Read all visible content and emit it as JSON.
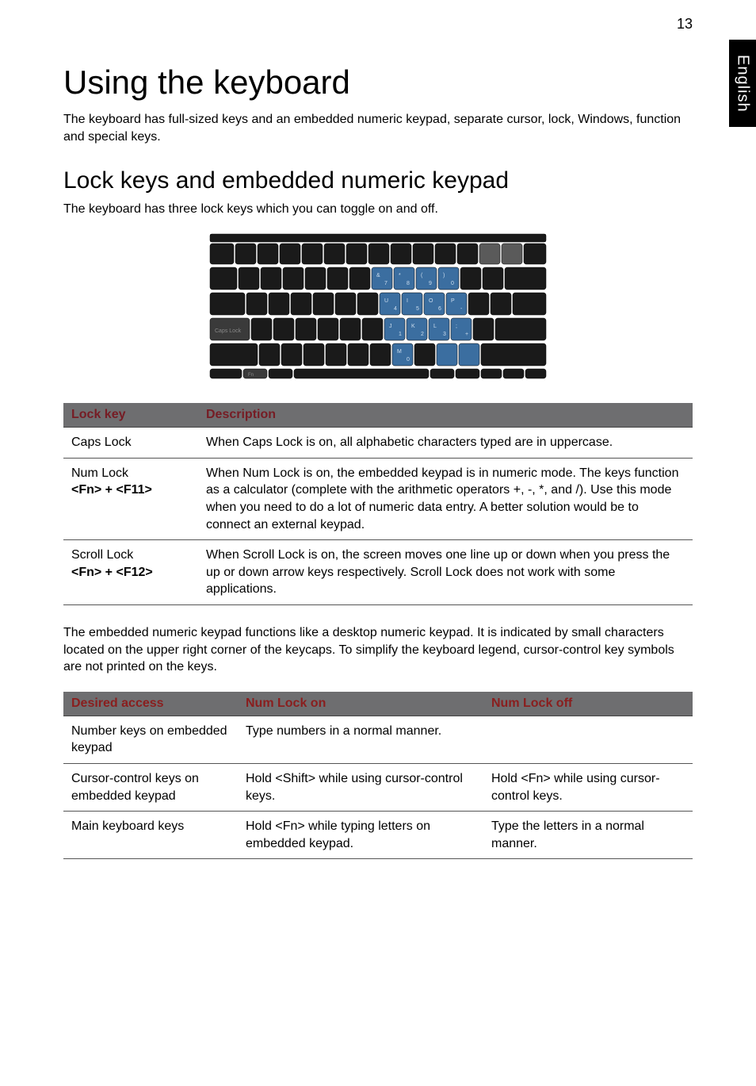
{
  "page_number": "13",
  "side_tab": "English",
  "h1": "Using the keyboard",
  "intro": "The keyboard has full-sized keys and an embedded numeric keypad, separate cursor, lock, Windows, function and special keys.",
  "h2": "Lock keys and embedded numeric keypad",
  "sub": "The keyboard has three lock keys which you can toggle on and off.",
  "table1": {
    "headers": [
      "Lock key",
      "Description"
    ],
    "rows": [
      {
        "key": "Caps Lock",
        "combo": "",
        "desc": "When Caps Lock is on, all alphabetic characters typed are in uppercase."
      },
      {
        "key": "Num Lock",
        "combo": "<Fn> + <F11>",
        "desc": "When Num Lock is on, the embedded keypad is in numeric mode. The keys function as a calculator (complete with the arithmetic operators +, -, *, and /). Use this mode when you need to do a lot of numeric data entry. A better solution would be to connect an external keypad."
      },
      {
        "key": "Scroll Lock",
        "combo": "<Fn> + <F12>",
        "desc": "When Scroll Lock is on, the screen moves one line up or down when you press the up or down arrow keys respectively. Scroll Lock does not work with some applications."
      }
    ]
  },
  "para": "The embedded numeric keypad functions like a desktop numeric keypad. It is indicated by small characters located on the upper right corner of the keycaps. To simplify the keyboard legend, cursor-control key symbols are not printed on the keys.",
  "table2": {
    "headers": [
      "Desired access",
      "Num Lock on",
      "Num Lock off"
    ],
    "rows": [
      {
        "access": "Number keys on embedded keypad",
        "on": "Type numbers in a normal manner.",
        "off": ""
      },
      {
        "access": "Cursor-control keys on embedded keypad",
        "on": "Hold <Shift> while using cursor-control keys.",
        "off": "Hold <Fn> while using cursor-control keys."
      },
      {
        "access": "Main keyboard keys",
        "on": "Hold <Fn> while typing letters on embedded keypad.",
        "off": "Type the letters in a normal manner."
      }
    ]
  }
}
